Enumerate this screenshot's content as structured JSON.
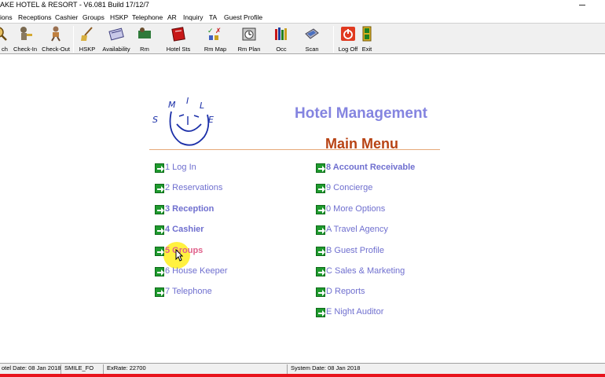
{
  "window": {
    "title": "AKE HOTEL & RESORT - V6.081 Build 17/12/7"
  },
  "menubar": [
    "ions",
    "Receptions",
    "Cashier",
    "Groups",
    "HSKP",
    "Telephone",
    "AR",
    "Inquiry",
    "TA",
    "Guest Profile"
  ],
  "toolbar": {
    "search": "ch",
    "checkin": "Check-In",
    "checkout": "Check-Out",
    "hskp": "HSKP",
    "availability": "Availability",
    "rm": "Rm",
    "hotel_sts": "Hotel Sts",
    "rm_map": "Rm Map",
    "rm_plan": "Rm Plan",
    "occ": "Occ",
    "scan": "Scan",
    "logoff": "Log Off",
    "exit": "Exit"
  },
  "logo": {
    "letters": [
      "S",
      "M",
      "I",
      "L",
      "E"
    ]
  },
  "header": {
    "app_title": "Hotel Management",
    "menu_title": "Main Menu"
  },
  "menu": {
    "left": [
      {
        "label": "1 Log In"
      },
      {
        "label": "2 Reservations"
      },
      {
        "label": "3 Reception"
      },
      {
        "label": "4 Cashier"
      },
      {
        "label": "5 Groups"
      },
      {
        "label": "6 House Keeper"
      },
      {
        "label": "7 Telephone"
      }
    ],
    "right": [
      {
        "label": "8 Account Receivable"
      },
      {
        "label": "9 Concierge"
      },
      {
        "label": "0 More Options"
      },
      {
        "label": "A Travel Agency"
      },
      {
        "label": "B Guest Profile"
      },
      {
        "label": "C Sales & Marketing"
      },
      {
        "label": "D Reports"
      },
      {
        "label": "E Night Auditor"
      }
    ]
  },
  "status": {
    "hotel_date": "otel Date: 08 Jan 2018",
    "user": "SMILE_FO",
    "exrate": "ExRate: 22700",
    "system_date": "System Date: 08 Jan 2018"
  },
  "colors": {
    "accent_blue": "#6f6fcf",
    "title_blue": "#8484e0",
    "menu_title": "#b84314",
    "arrow_green": "#1f9a2e",
    "status_red": "#e8141c"
  }
}
